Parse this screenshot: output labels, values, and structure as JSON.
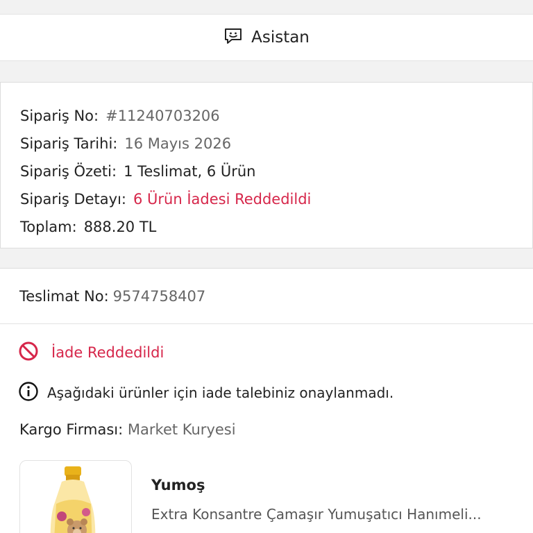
{
  "assistant": {
    "label": "Asistan",
    "icon": "chat-smile-icon"
  },
  "order": {
    "number": {
      "label": "Sipariş No:",
      "value": "#11240703206"
    },
    "date": {
      "label": "Sipariş Tarihi:",
      "value": "16 Mayıs 2026"
    },
    "summary": {
      "label": "Sipariş Özeti:",
      "value": "1 Teslimat, 6 Ürün"
    },
    "detail": {
      "label": "Sipariş Detayı:",
      "value": "6 Ürün İadesi Reddedildi"
    },
    "total": {
      "label": "Toplam:",
      "value": "888.20 TL"
    }
  },
  "delivery": {
    "number": {
      "label": "Teslimat No:",
      "value": "9574758407"
    },
    "status": {
      "text": "İade Reddedildi",
      "icon": "prohibited-icon",
      "color": "#d6264a"
    },
    "info": {
      "text": "Aşağıdaki ürünler için iade talebiniz onaylanmadı.",
      "icon": "info-circle-icon"
    },
    "cargo": {
      "label": "Kargo Firması:",
      "value": "Market Kuryesi"
    }
  },
  "product": {
    "brand": "Yumoş",
    "name": "Extra Konsantre Çamaşır Yumuşatıcı Hanımeli..."
  }
}
